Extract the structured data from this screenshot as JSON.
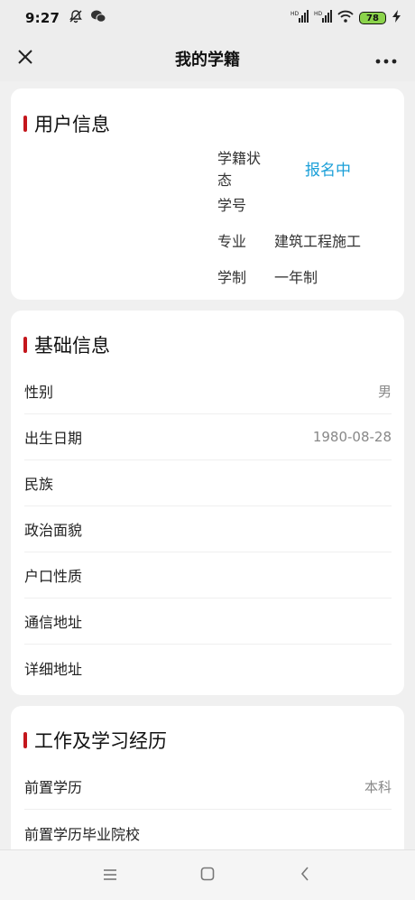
{
  "status_bar": {
    "time": "9:27",
    "battery": "78",
    "signal_1": "HD",
    "signal_2": "HD"
  },
  "header": {
    "title": "我的学籍"
  },
  "user_info": {
    "section_title": "用户信息",
    "rows": [
      {
        "label": "学籍状态",
        "value": "报名中"
      },
      {
        "label": "学号",
        "value": ""
      },
      {
        "label": "专业",
        "value": "建筑工程施工"
      },
      {
        "label": "学制",
        "value": "一年制"
      }
    ]
  },
  "basic_info": {
    "section_title": "基础信息",
    "rows": [
      {
        "label": "性别",
        "value": "男"
      },
      {
        "label": "出生日期",
        "value": "1980-08-28"
      },
      {
        "label": "民族",
        "value": ""
      },
      {
        "label": "政治面貌",
        "value": ""
      },
      {
        "label": "户口性质",
        "value": ""
      },
      {
        "label": "通信地址",
        "value": ""
      },
      {
        "label": "详细地址",
        "value": ""
      }
    ]
  },
  "experience": {
    "section_title": "工作及学习经历",
    "rows": [
      {
        "label": "前置学历",
        "value": "本科"
      },
      {
        "label": "前置学历毕业院校",
        "value": ""
      }
    ]
  },
  "colors": {
    "accent_bar": "#c4161c",
    "status_blue": "#1a9fd8"
  }
}
